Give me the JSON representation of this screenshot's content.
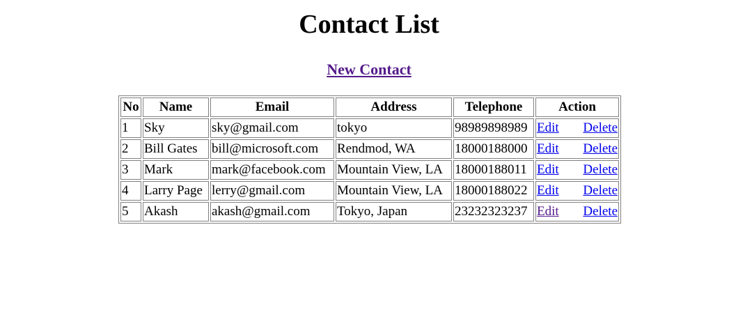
{
  "page": {
    "title": "Contact List",
    "new_contact_link": "New Contact"
  },
  "table": {
    "headers": {
      "no": "No",
      "name": "Name",
      "email": "Email",
      "address": "Address",
      "telephone": "Telephone",
      "action": "Action"
    },
    "rows": [
      {
        "no": "1",
        "name": "Sky",
        "email": "sky@gmail.com",
        "address": "tokyo",
        "telephone": "98989898989",
        "edit": "Edit",
        "delete": "Delete"
      },
      {
        "no": "2",
        "name": "Bill Gates",
        "email": "bill@microsoft.com",
        "address": "Rendmod, WA",
        "telephone": "18000188000",
        "edit": "Edit",
        "delete": "Delete"
      },
      {
        "no": "3",
        "name": "Mark",
        "email": "mark@facebook.com",
        "address": "Mountain View, LA",
        "telephone": "18000188011",
        "edit": "Edit",
        "delete": "Delete"
      },
      {
        "no": "4",
        "name": "Larry Page",
        "email": "lerry@gmail.com",
        "address": "Mountain View, LA",
        "telephone": "18000188022",
        "edit": "Edit",
        "delete": "Delete"
      },
      {
        "no": "5",
        "name": "Akash",
        "email": "akash@gmail.com",
        "address": "Tokyo, Japan",
        "telephone": "23232323237",
        "edit": "Edit",
        "delete": "Delete"
      }
    ]
  },
  "colors": {
    "link": "#0000ee",
    "visited_link": "#551a8b",
    "table_border": "#808080"
  }
}
